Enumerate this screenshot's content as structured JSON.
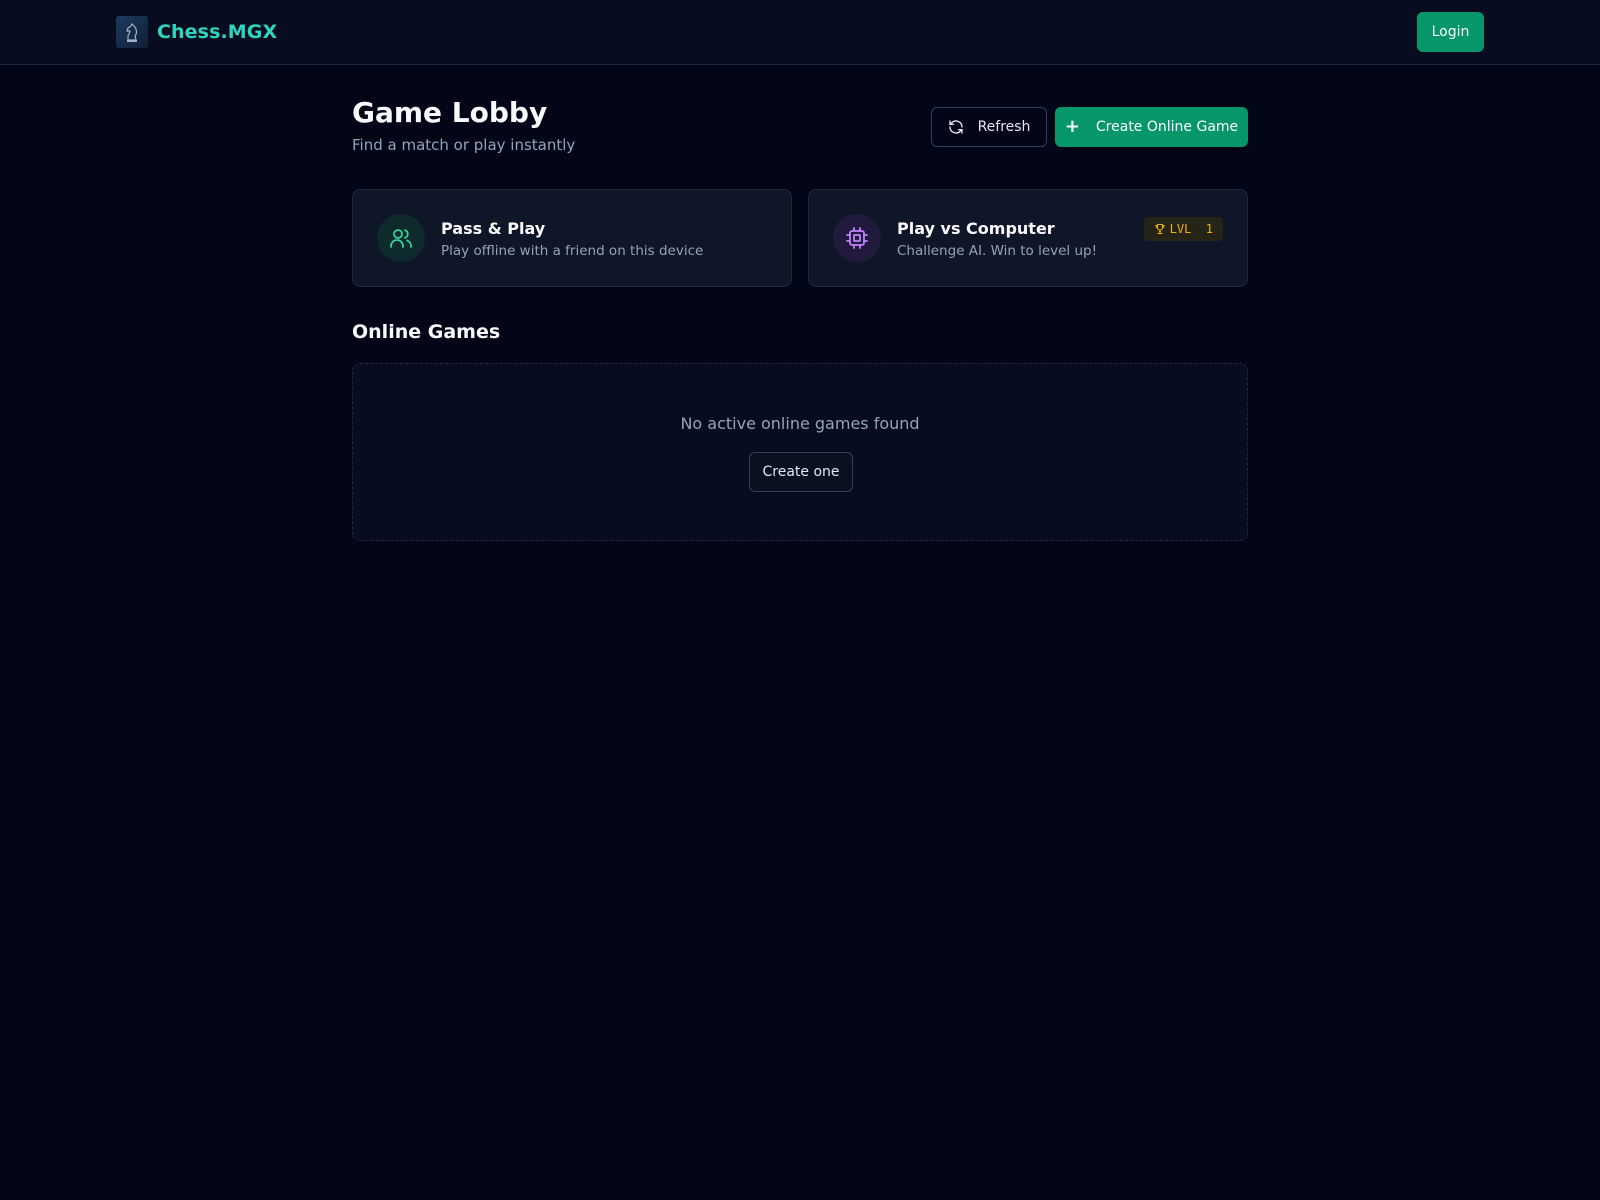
{
  "header": {
    "brand": "Chess.MGX",
    "logo_icon": "chess-knight-icon",
    "login_label": "Login"
  },
  "lobby": {
    "title": "Game Lobby",
    "subtitle": "Find a match or play instantly",
    "refresh_label": "Refresh",
    "create_label": "Create Online Game"
  },
  "modes": [
    {
      "title": "Pass & Play",
      "description": "Play offline with a friend on this device",
      "icon": "users-icon",
      "accent": "#34d399"
    },
    {
      "title": "Play vs Computer",
      "description": "Challenge AI. Win to level up!",
      "icon": "cpu-icon",
      "accent": "#c084fc",
      "badge": "LVL  1",
      "badge_icon": "trophy-icon"
    }
  ],
  "online": {
    "title": "Online Games",
    "empty_text": "No active online games found",
    "create_one_label": "Create one"
  },
  "colors": {
    "background": "#020617",
    "primary": "#059669",
    "brand": "#2dd4bf",
    "badge": "#eab308"
  }
}
